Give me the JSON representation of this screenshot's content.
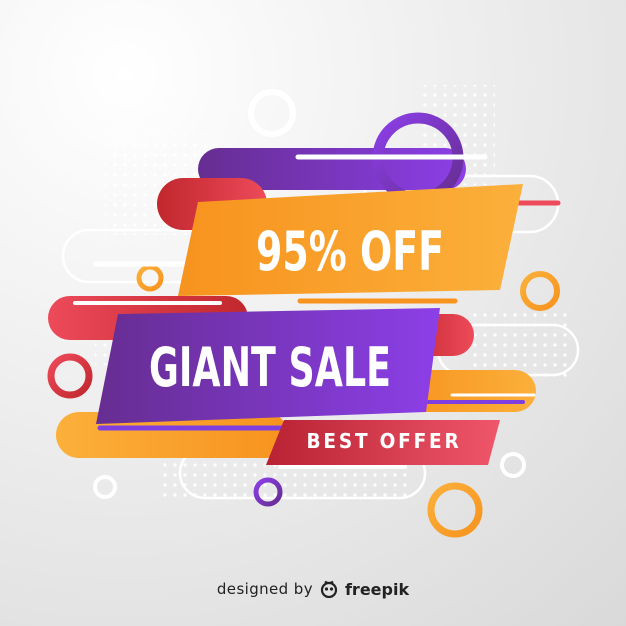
{
  "banner": {
    "discount_text": "95% OFF",
    "title_text": "GIANT SALE",
    "subtitle_text": "BEST OFFER"
  },
  "credit": {
    "prefix": "designed by",
    "brand": "freepik",
    "logo_icon": "freepik-logo-icon"
  },
  "colors": {
    "orange": "#f7931e",
    "orange_light": "#fbb03b",
    "purple": "#662d91",
    "violet": "#7f3fe0",
    "red": "#c1272d",
    "pink_red": "#ed4a5a",
    "background": "#eeeeee"
  }
}
